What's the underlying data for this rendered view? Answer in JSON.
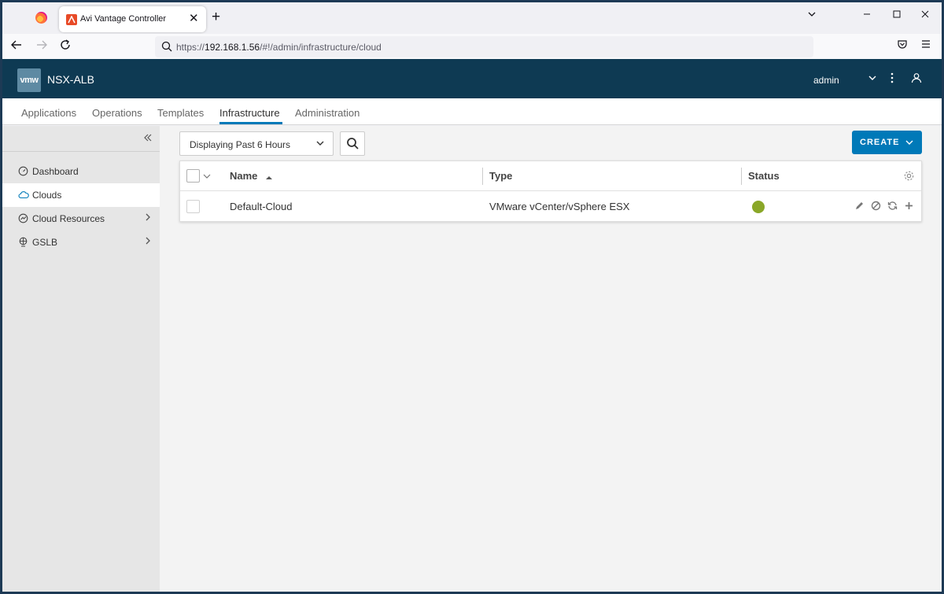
{
  "browser": {
    "tab_title": "Avi Vantage Controller",
    "tab_close": "✕",
    "new_tab": "+",
    "url_prefix": "https://",
    "url_host": "192.168.1.56",
    "url_path": "/#!/admin/infrastructure/cloud"
  },
  "header": {
    "logo_text": "vmw",
    "app_name": "NSX-ALB",
    "user": "admin"
  },
  "topnav": {
    "items": [
      "Applications",
      "Operations",
      "Templates",
      "Infrastructure",
      "Administration"
    ],
    "active": "Infrastructure"
  },
  "sidebar": {
    "items": [
      {
        "label": "Dashboard",
        "icon": "dashboard-icon",
        "active": false,
        "has_chevron": false
      },
      {
        "label": "Clouds",
        "icon": "cloud-icon",
        "active": true,
        "has_chevron": false
      },
      {
        "label": "Cloud Resources",
        "icon": "cloud-resources-icon",
        "active": false,
        "has_chevron": true
      },
      {
        "label": "GSLB",
        "icon": "globe-icon",
        "active": false,
        "has_chevron": true
      }
    ]
  },
  "toolbar": {
    "time_range": "Displaying Past 6 Hours",
    "create_label": "CREATE"
  },
  "table": {
    "columns": [
      "Name",
      "Type",
      "Status"
    ],
    "sort": {
      "column": "Name",
      "direction": "ascending"
    },
    "rows": [
      {
        "name": "Default-Cloud",
        "type": "VMware vCenter/vSphere ESX",
        "status": "up"
      }
    ]
  },
  "colors": {
    "header_bg": "#0e3a53",
    "accent": "#0079b8",
    "status_up": "#8aa728"
  }
}
